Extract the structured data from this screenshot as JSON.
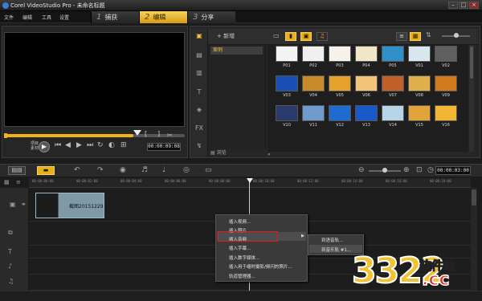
{
  "window": {
    "title": "Corel VideoStudio Pro - 未命名标题"
  },
  "menu": [
    "文件",
    "编辑",
    "工具",
    "设置"
  ],
  "steps": [
    {
      "num": "1",
      "label": "捕获"
    },
    {
      "num": "2",
      "label": "编辑"
    },
    {
      "num": "3",
      "label": "分享"
    }
  ],
  "player": {
    "mode_project": "项目",
    "mode_clip": "素材",
    "timecode": "00:00:09:08",
    "in_mark": "[",
    "out_mark": "]"
  },
  "library": {
    "add_label": "新增",
    "browse_label": "浏览",
    "folders": [
      "案例"
    ],
    "thumbnails": [
      {
        "label": "P01",
        "color": "#f4f4f4"
      },
      {
        "label": "P02",
        "color": "#f0f0f0"
      },
      {
        "label": "P03",
        "color": "#f6f2ea"
      },
      {
        "label": "P04",
        "color": "#f1e6c8"
      },
      {
        "label": "P05",
        "color": "#2f8fc6"
      },
      {
        "label": "V01",
        "color": "#d8e6ee"
      },
      {
        "label": "V02",
        "color": "#5f5f5f"
      },
      {
        "label": "V03",
        "color": "#1a4fb5"
      },
      {
        "label": "V04",
        "color": "#c98b2a"
      },
      {
        "label": "V05",
        "color": "#e4a12c"
      },
      {
        "label": "V06",
        "color": "#f1c47a"
      },
      {
        "label": "V07",
        "color": "#c0602a"
      },
      {
        "label": "V08",
        "color": "#dfb04c"
      },
      {
        "label": "V09",
        "color": "#d17a1c"
      },
      {
        "label": "V10",
        "color": "#2a3a6a"
      },
      {
        "label": "V11",
        "color": "#6f9acb"
      },
      {
        "label": "V12",
        "color": "#1f6bd0"
      },
      {
        "label": "V13",
        "color": "#1958c9"
      },
      {
        "label": "V14",
        "color": "#b8d4e8"
      },
      {
        "label": "V15",
        "color": "#e1a43a"
      },
      {
        "label": "V16",
        "color": "#f0b634"
      }
    ]
  },
  "timeline": {
    "timecode": "00:00:03:00",
    "ruler": [
      "00:00:00:00",
      "00:00:02:00",
      "00:00:04:00",
      "00:00:06:00",
      "00:00:08:00",
      "00:00:10:00",
      "00:00:12:00",
      "00:00:14:00",
      "00:00:16:00",
      "00:00:18:00"
    ],
    "clip_label": "截图20151229"
  },
  "context_menu": {
    "items": [
      "插入视频...",
      "插入照片...",
      "插入音频",
      "插入字幕...",
      "插入数字媒体...",
      "插入用于缩时摄影/频闪的照片...",
      "轨道管理器..."
    ],
    "highlighted_index": 2,
    "submenu": [
      "到语音轨...",
      "到音乐轨 #1..."
    ]
  },
  "watermark": {
    "number": "3322",
    "site": "软件站",
    "domain": ".cc"
  }
}
